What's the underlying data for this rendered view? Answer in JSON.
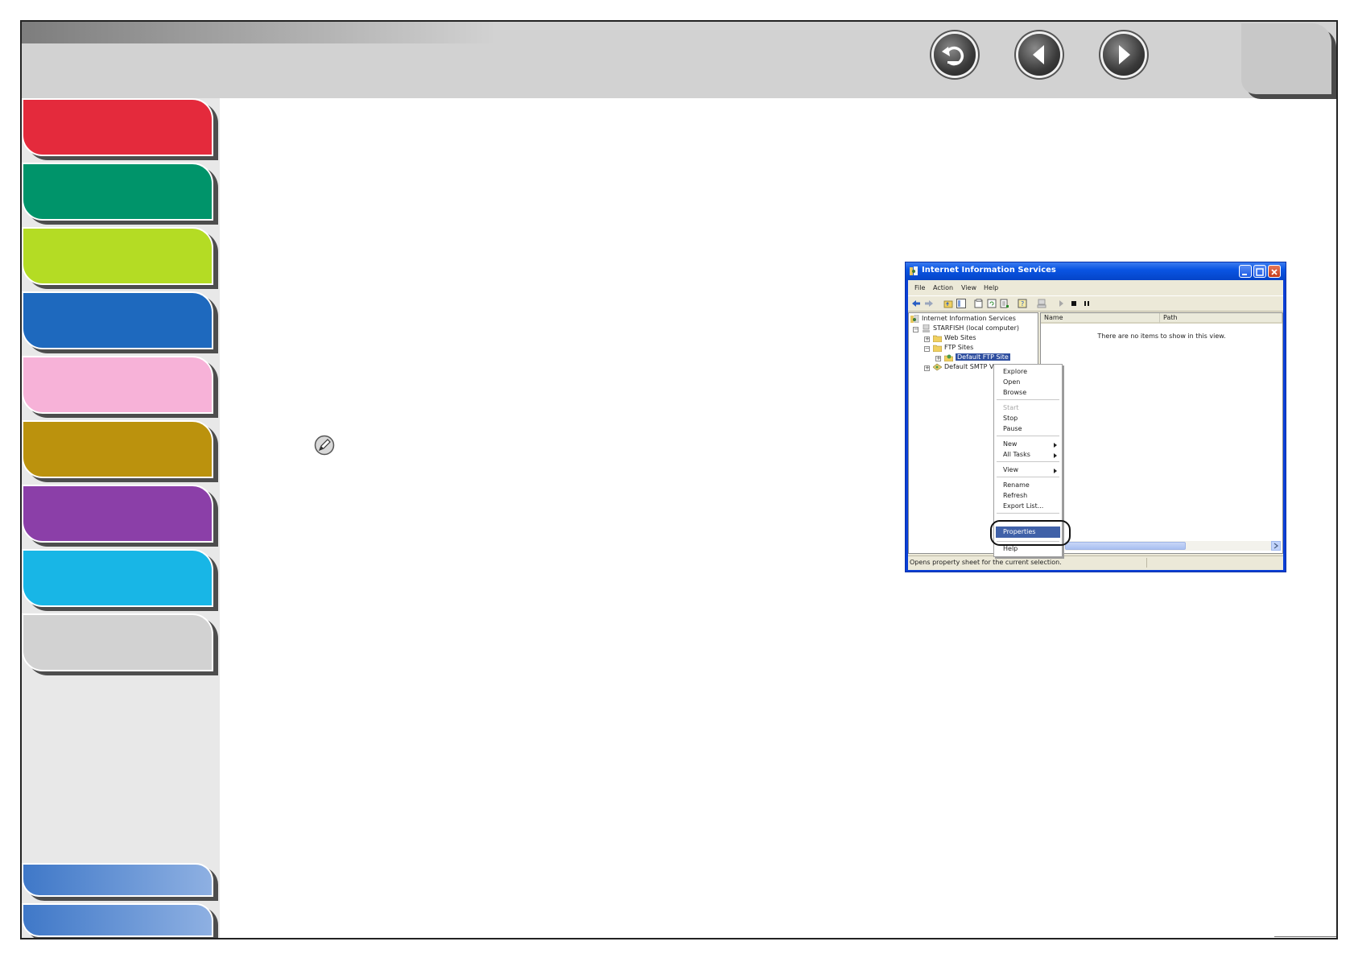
{
  "navigation": {
    "back_icon": "return-arrow-icon",
    "prev_icon": "left-triangle-icon",
    "next_icon": "right-triangle-icon"
  },
  "colors": {
    "sidebar_tabs": [
      "#e42a3c",
      "#00946a",
      "#b4dc24",
      "#1e69be",
      "#f7b2d8",
      "#bb920d",
      "#8b3fa8",
      "#18b6e6",
      "#d2d2d2"
    ],
    "sidebar_bottom_tabs": [
      "#3f78c8",
      "#3f78c8"
    ],
    "header": "#d2d2d2",
    "window_title": "#0a55e3",
    "highlight": "#4061a8"
  },
  "note_icon": "pencil-note-icon",
  "screenshot": {
    "title": "Internet Information Services",
    "menu": [
      "File",
      "Action",
      "View",
      "Help"
    ],
    "tree": {
      "root": "Internet Information Services",
      "computer": "STARFISH (local computer)",
      "web_sites": "Web Sites",
      "ftp_sites": "FTP Sites",
      "default_ftp": "Default FTP Site",
      "default_smtp": "Default SMTP Vir"
    },
    "columns": [
      "Name",
      "Path"
    ],
    "empty_message": "There are no items to show in this view.",
    "context_menu": {
      "explore": "Explore",
      "open": "Open",
      "browse": "Browse",
      "start": "Start",
      "stop": "Stop",
      "pause": "Pause",
      "new": "New",
      "all_tasks": "All Tasks",
      "view": "View",
      "rename": "Rename",
      "refresh": "Refresh",
      "export": "Export List...",
      "properties": "Properties",
      "help": "Help"
    },
    "status": "Opens property sheet for the current selection."
  }
}
